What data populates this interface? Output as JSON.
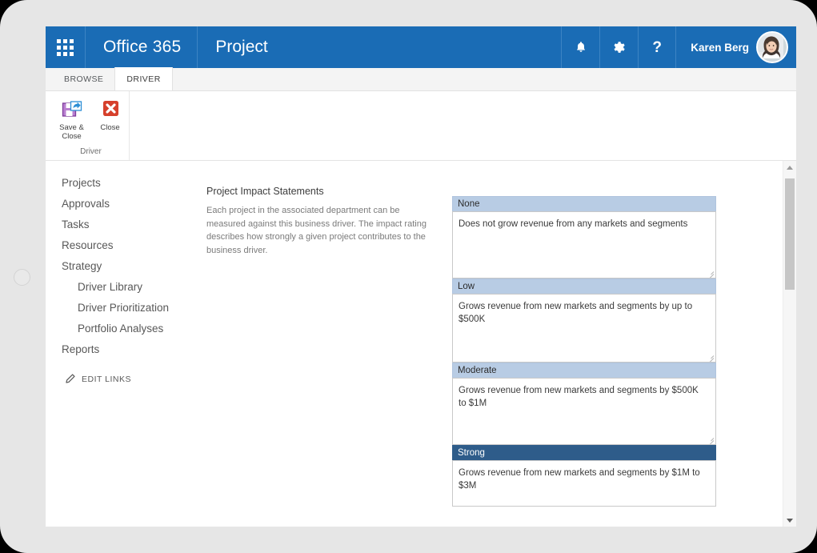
{
  "suitebar": {
    "waffle_icon": "app-launcher-grid-icon",
    "brand": "Office 365",
    "app": "Project",
    "notifications_icon": " 🔔",
    "settings_icon": "⚙",
    "help_icon": "?",
    "user_name": "Karen Berg",
    "accent_color": "#1a6cb5"
  },
  "ribbon": {
    "tabs": [
      {
        "label": "BROWSE",
        "active": false
      },
      {
        "label": "DRIVER",
        "active": true
      }
    ],
    "buttons": [
      {
        "label": "Save &\nClose",
        "icon": "save-and-close-icon"
      },
      {
        "label": "Close",
        "icon": "close-x-icon"
      }
    ],
    "save_close_label_line1": "Save &",
    "save_close_label_line2": "Close",
    "close_label": "Close",
    "group_label": "Driver"
  },
  "sidebar": {
    "items": [
      {
        "label": "Projects",
        "sub": false
      },
      {
        "label": "Approvals",
        "sub": false
      },
      {
        "label": "Tasks",
        "sub": false
      },
      {
        "label": "Resources",
        "sub": false
      },
      {
        "label": "Strategy",
        "sub": false
      },
      {
        "label": "Driver Library",
        "sub": true
      },
      {
        "label": "Driver Prioritization",
        "sub": true
      },
      {
        "label": "Portfolio Analyses",
        "sub": true
      },
      {
        "label": "Reports",
        "sub": false
      }
    ],
    "edit_links_label": "EDIT LINKS",
    "edit_links_icon": "pencil-icon"
  },
  "description": {
    "title": "Project Impact Statements",
    "body": "Each project in the associated department can be measured against this business driver. The impact rating describes how strongly a given project contributes to the business driver."
  },
  "impact_statements": [
    {
      "rating": "None",
      "statement": "Does not grow revenue from any markets and segments",
      "selected": false
    },
    {
      "rating": "Low",
      "statement": "Grows revenue from new markets and segments by up to $500K",
      "selected": false
    },
    {
      "rating": "Moderate",
      "statement": "Grows revenue from new markets and segments by $500K to $1M",
      "selected": false
    },
    {
      "rating": "Strong",
      "statement": "Grows revenue from new markets and segments by $1M to $3M",
      "selected": true
    }
  ],
  "colors": {
    "header_blue": "#1a6cb5",
    "panel_header": "#b8cce4",
    "panel_header_selected": "#2e5c8a"
  }
}
